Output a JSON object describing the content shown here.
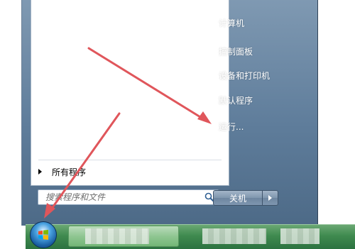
{
  "start_menu": {
    "right_items": [
      {
        "label": "计算机",
        "name": "menu-item-computer"
      },
      {
        "label": "控制面板",
        "name": "menu-item-control-panel"
      },
      {
        "label": "设备和打印机",
        "name": "menu-item-devices-printers"
      },
      {
        "label": "默认程序",
        "name": "menu-item-default-programs"
      },
      {
        "label": "运行...",
        "name": "menu-item-run"
      }
    ],
    "all_programs_label": "所有程序",
    "search_placeholder": "搜索程序和文件",
    "shutdown_label": "关机"
  },
  "icons": {
    "search": "search-icon",
    "start": "windows-logo-icon",
    "shutdown_menu": "chevron-right-icon"
  },
  "colors": {
    "annotation_arrow": "#e0565b",
    "taskbar": "#3f8a4f",
    "menu_right_pane": "#5f7d9b"
  }
}
